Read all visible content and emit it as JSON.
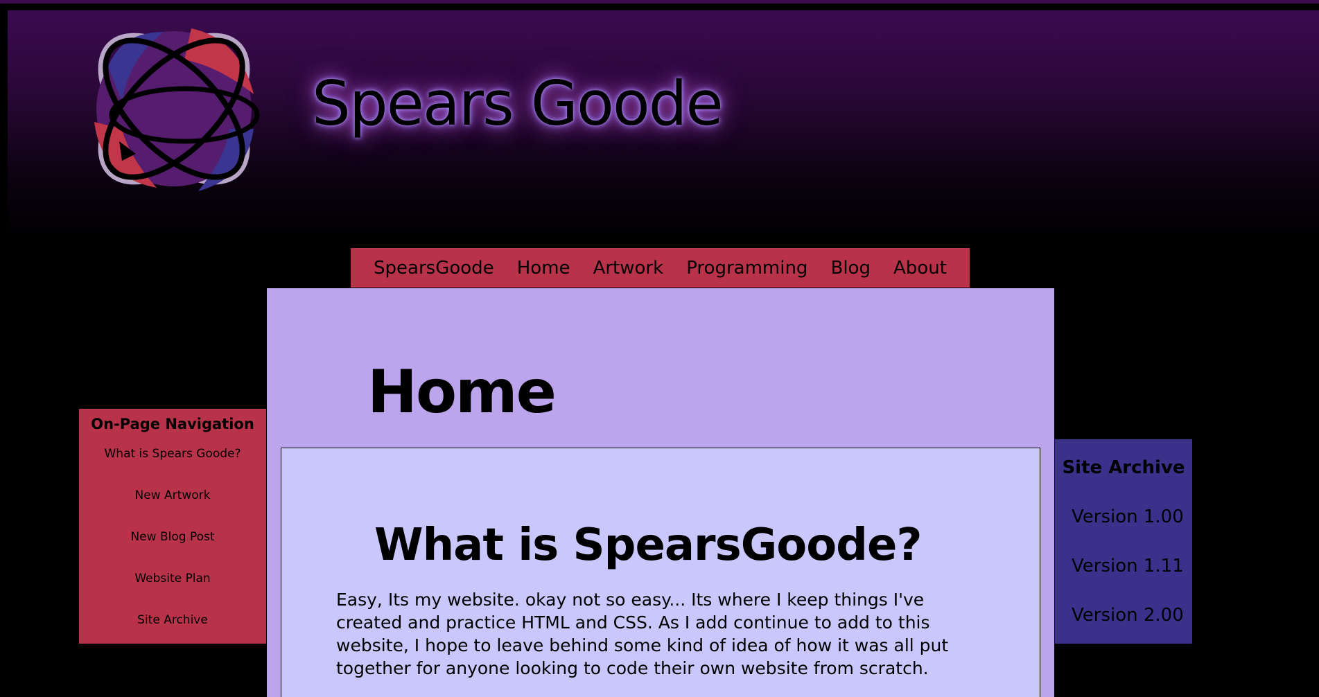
{
  "site": {
    "title": "Spears Goode"
  },
  "nav": {
    "items": [
      {
        "label": "SpearsGoode"
      },
      {
        "label": "Home"
      },
      {
        "label": "Artwork"
      },
      {
        "label": "Programming"
      },
      {
        "label": "Blog"
      },
      {
        "label": "About"
      }
    ]
  },
  "main": {
    "page_title": "Home",
    "section": {
      "title": "What is SpearsGoode?",
      "body": "Easy, Its my website. okay not so easy... Its where I keep things I've created and practice HTML and CSS. As I add continue to add to this website, I hope to leave behind some kind of idea of how it was all put together for anyone looking to code their own website from scratch."
    }
  },
  "left_nav": {
    "title": "On-Page Navigation",
    "items": [
      {
        "label": "What is Spears Goode?"
      },
      {
        "label": "New Artwork"
      },
      {
        "label": "New Blog Post"
      },
      {
        "label": "Website Plan"
      },
      {
        "label": "Site Archive"
      }
    ]
  },
  "archive": {
    "title": "Site Archive",
    "items": [
      {
        "label": "Version 1.00"
      },
      {
        "label": "Version 1.11"
      },
      {
        "label": "Version 2.00"
      }
    ]
  },
  "colors": {
    "header_top": "#3b0a50",
    "nav_bg": "#b83349",
    "main_bg": "#bca5ec",
    "content_bg": "#cac7fc",
    "archive_bg": "#3b318a",
    "logo_red": "#c2364a",
    "logo_blue": "#3a3590",
    "logo_purple": "#561d6e"
  },
  "icons": {
    "logo": "orbital-logo-icon"
  }
}
